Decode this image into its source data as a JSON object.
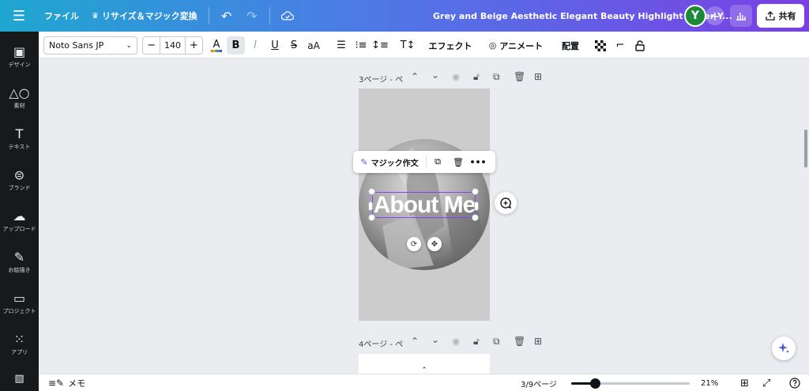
{
  "topbar": {
    "file_label": "ファイル",
    "resize_label": "リサイズ＆マジック変換",
    "doc_title": "Grey and Beige Aesthetic Elegant Beauty  Highlight Cover Y...",
    "avatar_initial": "Y",
    "share_label": "共有"
  },
  "sidebar": {
    "items": [
      {
        "label": "デザイン",
        "icon": "layout-icon"
      },
      {
        "label": "素材",
        "icon": "shapes-icon"
      },
      {
        "label": "テキスト",
        "icon": "text-icon"
      },
      {
        "label": "ブランド",
        "icon": "brand-icon"
      },
      {
        "label": "アップロード",
        "icon": "upload-cloud-icon"
      },
      {
        "label": "お絵描き",
        "icon": "draw-icon"
      },
      {
        "label": "プロジェクト",
        "icon": "folder-icon"
      },
      {
        "label": "アプリ",
        "icon": "apps-grid-icon"
      }
    ]
  },
  "toolbar": {
    "font_family": "Noto Sans JP",
    "font_size": "140",
    "effects_label": "エフェクト",
    "animate_label": "アニメート",
    "position_label": "配置"
  },
  "canvas": {
    "page3_label": "3ページ - ぺ",
    "page4_label": "4ページ - ぺ",
    "text_content": "About Me",
    "magic_write_label": "マジック作文"
  },
  "bottombar": {
    "notes_label": "メモ",
    "page_indicator": "3/9ページ",
    "zoom_level": "21%",
    "zoom_fraction": 0.2
  },
  "colors": {
    "selection": "#8b3dff",
    "topbar_start": "#1ea7d0",
    "topbar_end": "#7b3fe4"
  }
}
